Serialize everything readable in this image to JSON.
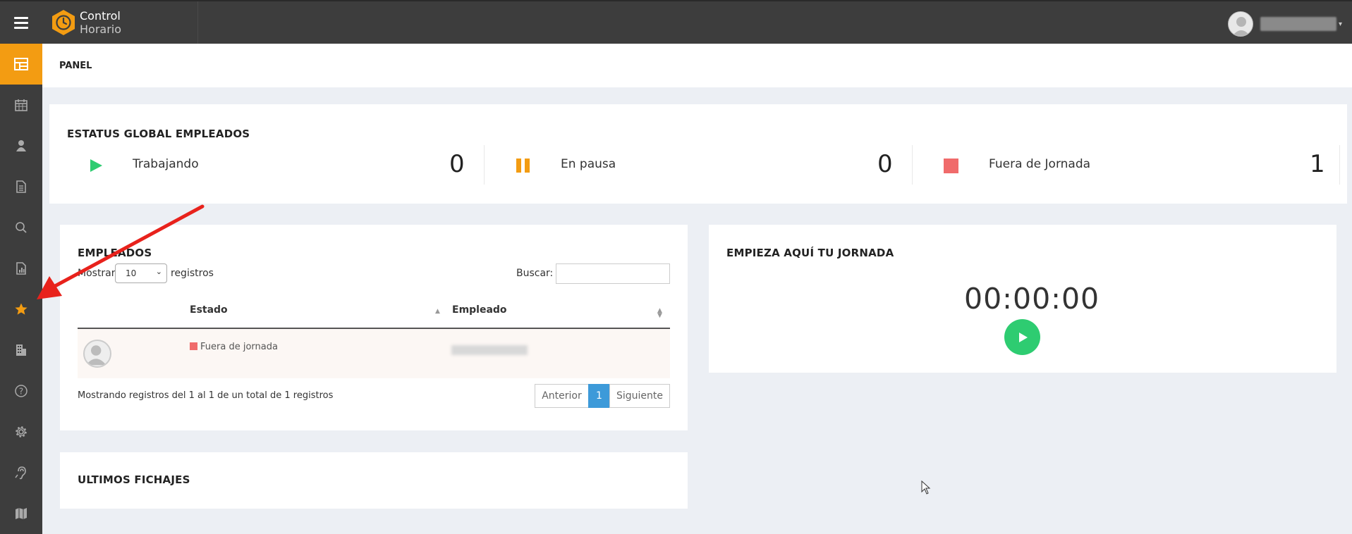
{
  "app": {
    "name_line1": "Control",
    "name_line2": "Horario"
  },
  "topbar": {
    "menu_icon": "hamburger-icon",
    "user_avatar_icon": "user-avatar-icon"
  },
  "sidebar": {
    "items": [
      {
        "icon": "dashboard-icon",
        "active": true
      },
      {
        "icon": "calendar-icon",
        "active": false
      },
      {
        "icon": "user-icon",
        "active": false
      },
      {
        "icon": "document-icon",
        "active": false
      },
      {
        "icon": "search-icon",
        "active": false
      },
      {
        "icon": "report-icon",
        "active": false
      },
      {
        "icon": "star-icon",
        "active": false
      },
      {
        "icon": "building-icon",
        "active": false
      },
      {
        "icon": "help-icon",
        "active": false
      },
      {
        "icon": "gear-icon",
        "active": false
      },
      {
        "icon": "hearing-icon",
        "active": false
      },
      {
        "icon": "map-icon",
        "active": false
      }
    ]
  },
  "header": {
    "title": "PANEL"
  },
  "status_global": {
    "title": "ESTATUS GLOBAL EMPLEADOS",
    "items": [
      {
        "label": "Trabajando",
        "count": "0",
        "icon": "play-icon",
        "color": "#2ecc71"
      },
      {
        "label": "En pausa",
        "count": "0",
        "icon": "pause-icon",
        "color": "#f39c12"
      },
      {
        "label": "Fuera de Jornada",
        "count": "1",
        "icon": "stop-icon",
        "color": "#f06b6b"
      }
    ]
  },
  "empleados": {
    "title": "EMPLEADOS",
    "show_label": "Mostrar",
    "page_size": "10",
    "records_label": "registros",
    "search_label": "Buscar:",
    "columns": [
      "Estado",
      "Empleado"
    ],
    "rows": [
      {
        "estado": "Fuera de jornada",
        "estado_color": "#f06b6b"
      }
    ],
    "info": "Mostrando registros del 1 al 1 de un total de 1 registros",
    "pagination": {
      "prev": "Anterior",
      "current": "1",
      "next": "Siguiente"
    }
  },
  "jornada": {
    "title": "EMPIEZA AQUÍ TU JORNADA",
    "timer": "00:00:00"
  },
  "fichajes": {
    "title": "ULTIMOS FICHAJES"
  },
  "colors": {
    "accent": "#f39c12",
    "sidebar_bg": "#3d3d3d",
    "primary": "#3d9ad9",
    "success": "#2ecc71",
    "danger": "#f06b6b"
  }
}
